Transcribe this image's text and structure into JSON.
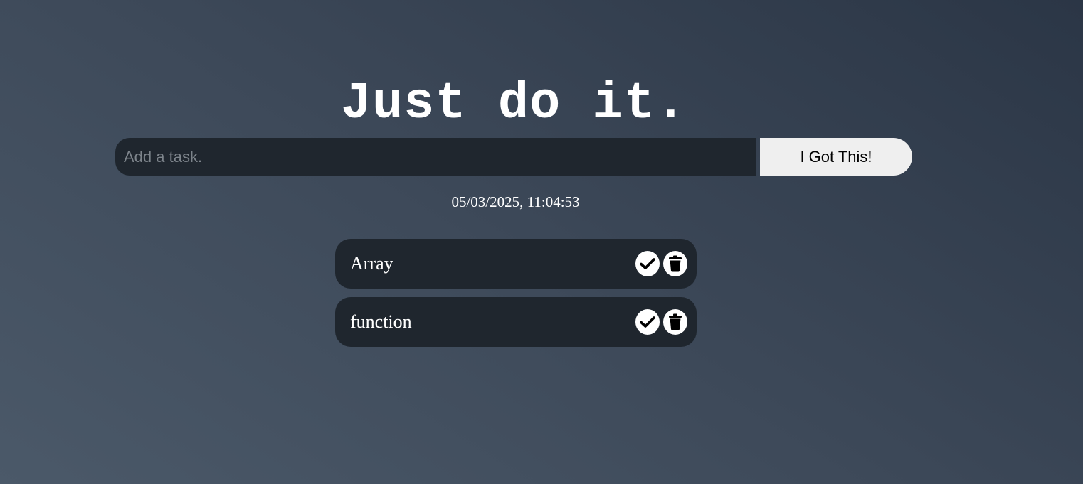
{
  "header": {
    "title": "Just do it."
  },
  "task_form": {
    "input_placeholder": "Add a task.",
    "input_value": "",
    "submit_label": "I Got This!"
  },
  "datetime": "05/03/2025, 11:04:53",
  "tasks": [
    {
      "text": "Array",
      "complete_icon": "check-icon",
      "delete_icon": "trash-icon"
    },
    {
      "text": "function",
      "complete_icon": "check-icon",
      "delete_icon": "trash-icon"
    }
  ],
  "colors": {
    "background_light": "#4b5969",
    "background_dark": "#2b3646",
    "surface": "#1f262e",
    "button": "#efefef",
    "text": "#ffffff"
  }
}
